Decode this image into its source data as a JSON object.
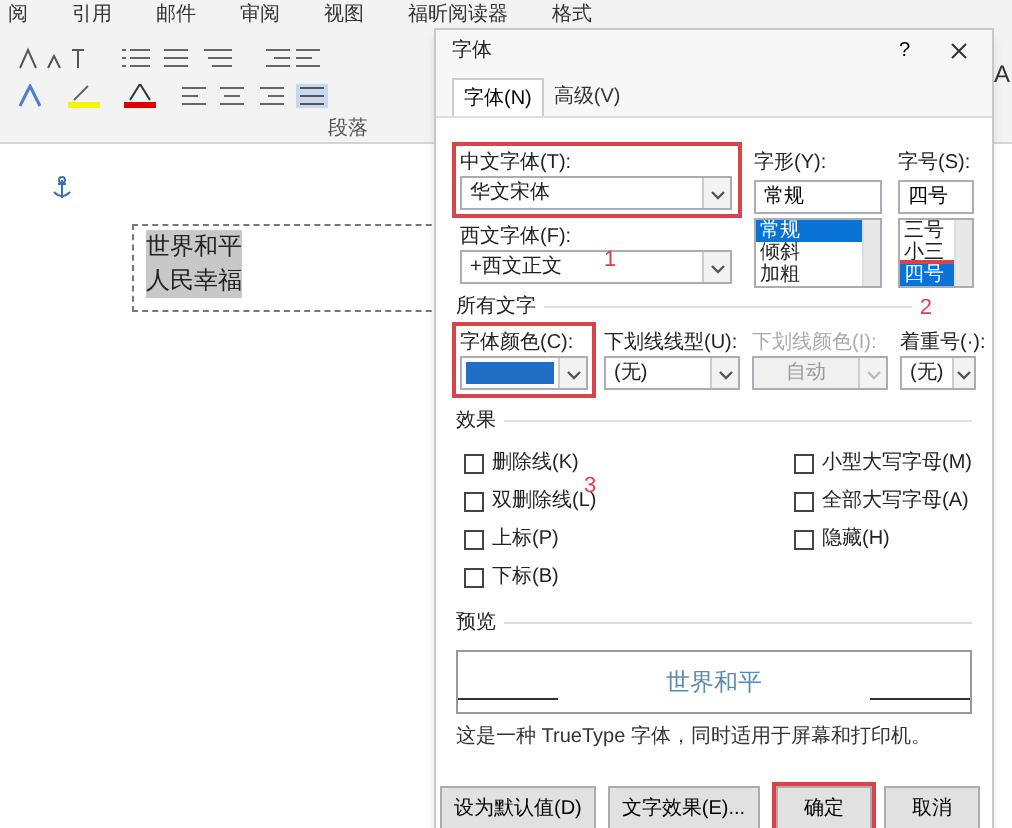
{
  "ribbon": {
    "tabs": [
      {
        "label": "阅"
      },
      {
        "label": "引用"
      },
      {
        "label": "邮件"
      },
      {
        "label": "审阅"
      },
      {
        "label": "视图"
      },
      {
        "label": "福昕阅读器"
      },
      {
        "label": "格式"
      }
    ],
    "group_label": "段落",
    "behind_text": "A"
  },
  "document": {
    "lines": [
      "世界和平",
      "人民幸福"
    ]
  },
  "dialog": {
    "title": "字体",
    "help": "?",
    "tabs": [
      {
        "label": "字体(N)",
        "selected": true
      },
      {
        "label": "高级(V)",
        "selected": false
      }
    ],
    "chinese_font": {
      "label": "中文字体(T):",
      "value": "华文宋体",
      "highlighted": true
    },
    "western_font": {
      "label": "西文字体(F):",
      "value": "+西文正文",
      "highlighted": false
    },
    "style": {
      "label": "字形(Y):",
      "value": "常规",
      "options": [
        {
          "label": "常规",
          "selected": true,
          "highlighted": false
        },
        {
          "label": "倾斜",
          "selected": false,
          "highlighted": false
        },
        {
          "label": "加粗",
          "selected": false,
          "highlighted": false
        }
      ]
    },
    "size": {
      "label": "字号(S):",
      "value": "四号",
      "options": [
        {
          "label": "三号",
          "selected": false,
          "highlighted": false
        },
        {
          "label": "小三",
          "selected": false,
          "highlighted": false
        },
        {
          "label": "四号",
          "selected": true,
          "highlighted": true
        }
      ]
    },
    "all_text": {
      "heading": "所有文字",
      "font_color": {
        "label": "字体颜色(C):",
        "color": "#1f6fc6",
        "highlighted": true
      },
      "underline_style": {
        "label": "下划线线型(U):",
        "value": "(无)",
        "disabled": false
      },
      "underline_color": {
        "label": "下划线颜色(I):",
        "value": "自动",
        "disabled": true
      },
      "emphasis": {
        "label": "着重号(·):",
        "value": "(无)",
        "disabled": false
      }
    },
    "effects": {
      "heading": "效果",
      "left": [
        {
          "label": "删除线(K)",
          "checked": false
        },
        {
          "label": "双删除线(L)",
          "checked": false
        },
        {
          "label": "上标(P)",
          "checked": false
        },
        {
          "label": "下标(B)",
          "checked": false
        }
      ],
      "right": [
        {
          "label": "小型大写字母(M)",
          "checked": false
        },
        {
          "label": "全部大写字母(A)",
          "checked": false
        },
        {
          "label": "隐藏(H)",
          "checked": false
        }
      ]
    },
    "preview": {
      "heading": "预览",
      "sample": "世界和平",
      "note": "这是一种 TrueType 字体，同时适用于屏幕和打印机。"
    },
    "buttons": [
      {
        "label": "设为默认值(D)",
        "highlighted": false
      },
      {
        "label": "文字效果(E)...",
        "highlighted": false
      },
      {
        "label": "确定",
        "highlighted": true
      },
      {
        "label": "取消",
        "highlighted": false
      }
    ]
  },
  "annotations": [
    {
      "label": "1"
    },
    {
      "label": "2"
    },
    {
      "label": "3"
    }
  ]
}
